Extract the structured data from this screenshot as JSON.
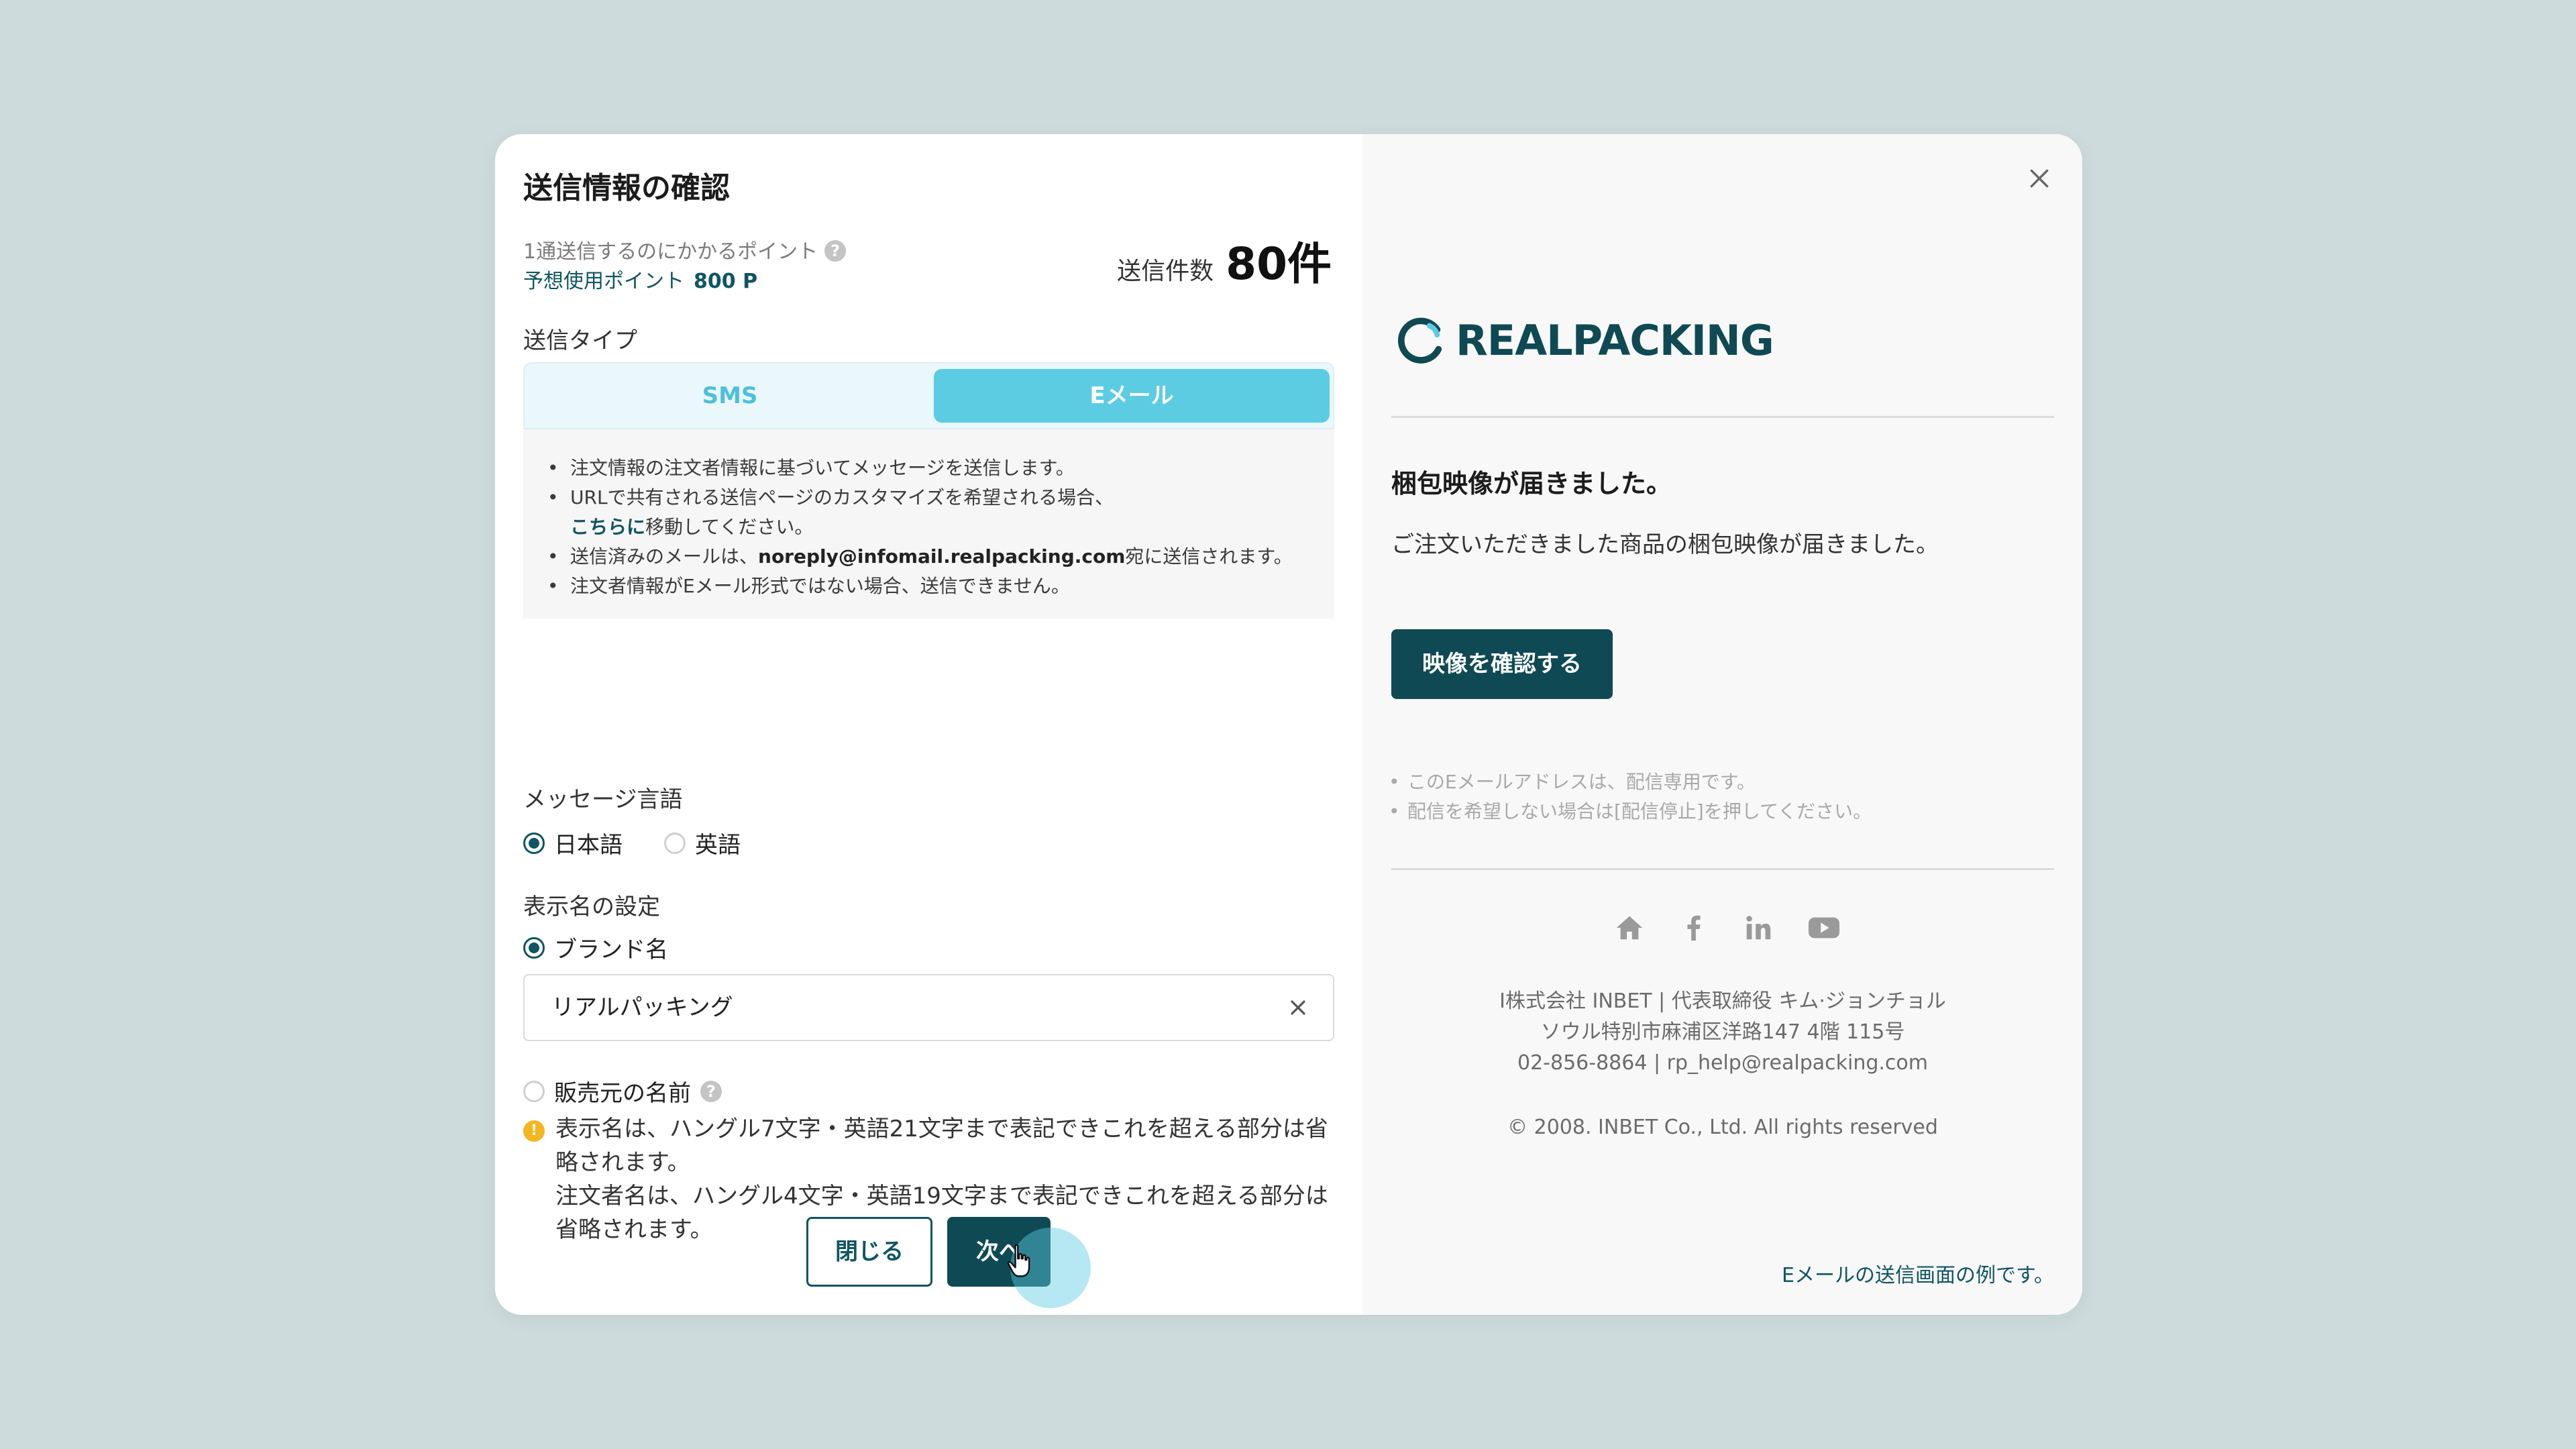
{
  "modal": {
    "title": "送信情報の確認",
    "cost_label": "1通送信するのにかかるポイント",
    "estimate_label": "予想使用ポイント",
    "estimate_value": "800 P",
    "count_label": "送信件数",
    "count_value": "80件",
    "send_type_label": "送信タイプ",
    "tabs": [
      {
        "label": "SMS",
        "selected": false
      },
      {
        "label": "Eメール",
        "selected": true
      }
    ],
    "notes": {
      "line1": "注文情報の注文者情報に基づいてメッセージを送信します。",
      "line2": "URLで共有される送信ページのカスタマイズを希望される場合、",
      "line2_link": "こちらに",
      "line2_rest": "移動してください。",
      "line3_pre": "送信済みのメールは、",
      "line3_email": "noreply@infomail.realpacking.com",
      "line3_post": "宛に送信されます。",
      "line4": "注文者情報がEメール形式ではない場合、送信できません。"
    },
    "language_label": "メッセージ言語",
    "languages": [
      {
        "label": "日本語",
        "selected": true
      },
      {
        "label": "英語",
        "selected": false
      }
    ],
    "display_name_label": "表示名の設定",
    "brand_option": "ブランド名",
    "brand_input_value": "リアルパッキング",
    "seller_option": "販売元の名前",
    "warning_line1": "表示名は、ハングル7文字・英語21文字まで表記できこれを超える部分は省略されます。",
    "warning_line2": "注文者名は、ハングル4文字・英語19文字まで表記できこれを超える部分は省略されます。",
    "close_button": "閉じる",
    "next_button": "次へ"
  },
  "preview": {
    "logo_text": "REALPACKING",
    "message_title": "梱包映像が届きました。",
    "message_body": "ご注文いただきました商品の梱包映像が届きました。",
    "video_button": "映像を確認する",
    "notes": [
      "このEメールアドレスは、配信専用です。",
      "配信を希望しない場合は[配信停止]を押してください。"
    ],
    "social_icons": [
      "home-icon",
      "facebook-icon",
      "linkedin-icon",
      "youtube-icon"
    ],
    "footer_line1": "I株式会社 INBET | 代表取締役 キム·ジョンチョル",
    "footer_line2": "ソウル特別市麻浦区洋路147 4階 115号",
    "footer_line3": "02-856-8864 | rp_help@realpacking.com",
    "copyright": "© 2008. INBET Co., Ltd. All rights reserved",
    "example_note": "Eメールの送信画面の例です。"
  },
  "colors": {
    "background": "#cddbdc",
    "primary": "#0f4a54",
    "accent": "#5ccce3",
    "warning": "#f3b520"
  }
}
